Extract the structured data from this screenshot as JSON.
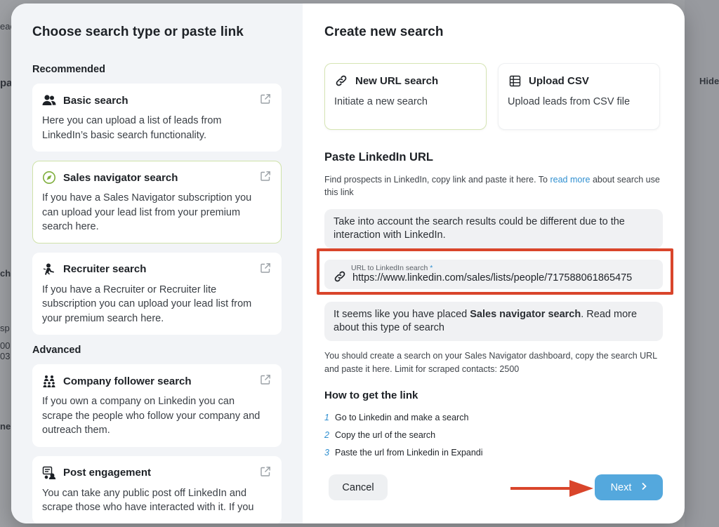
{
  "background": {
    "fragments": [
      "eac",
      "pa",
      "Hide",
      "ch",
      "ne",
      "00",
      "sp",
      "03"
    ]
  },
  "left_panel": {
    "title": "Choose search type or paste link",
    "recommended_label": "Recommended",
    "advanced_label": "Advanced",
    "recommended": [
      {
        "title": "Basic search",
        "desc": "Here you can upload a list of leads from LinkedIn’s basic search functionality.",
        "icon": "users-icon"
      },
      {
        "title": "Sales navigator search",
        "desc": "If you have a Sales Navigator subscription you can upload your lead list from your premium search here.",
        "icon": "compass-icon"
      },
      {
        "title": "Recruiter search",
        "desc": "If you have a Recruiter or Recruiter lite subscription you can upload your lead list from your premium search here.",
        "icon": "recruiter-icon"
      }
    ],
    "advanced": [
      {
        "title": "Company follower search",
        "desc": "If you own a company on Linkedin you can scrape the people who follow your company and outreach them.",
        "icon": "company-followers-icon"
      },
      {
        "title": "Post engagement",
        "desc": "You can take any public post off LinkedIn and scrape those who have interacted with it. If you",
        "icon": "post-engagement-icon"
      }
    ]
  },
  "right_panel": {
    "title": "Create new search",
    "tiles": [
      {
        "title": "New URL search",
        "desc": "Initiate a new search",
        "icon": "link-icon"
      },
      {
        "title": "Upload CSV",
        "desc": "Upload leads from CSV file",
        "icon": "table-icon"
      }
    ],
    "paste_heading": "Paste LinkedIn URL",
    "hint_before": "Find prospects in LinkedIn, copy link and paste it here. To ",
    "hint_link": "read more",
    "hint_after": " about search use this link",
    "note1": "Take into account the search results could be different due to the interaction with LinkedIn.",
    "url_label": "URL to LinkedIn search",
    "url_required": "*",
    "url_value": "https://www.linkedin.com/sales/lists/people/717588061865475",
    "note2_before": "It seems like you have placed ",
    "note2_bold": "Sales navigator search",
    "note2_after": ". Read more about this type of search",
    "sub_text": "You should create a search on your Sales Navigator dashboard, copy the search URL and paste it here. Limit for scraped contacts: 2500",
    "how_heading": "How to get the link",
    "steps": [
      {
        "n": "1",
        "text": "Go to Linkedin and make a search"
      },
      {
        "n": "2",
        "text": "Copy the url of the search"
      },
      {
        "n": "3",
        "text": "Paste the url from Linkedin in Expandi"
      }
    ],
    "cancel_label": "Cancel",
    "next_label": "Next"
  },
  "colors": {
    "accent_blue": "#54a8dd",
    "highlight_red": "#d9452b",
    "selected_border": "#cfe2a8"
  }
}
